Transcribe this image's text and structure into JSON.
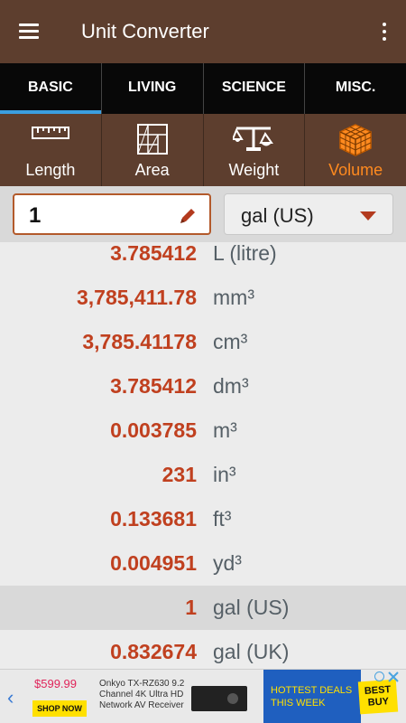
{
  "app": {
    "title": "Unit Converter"
  },
  "tabs": [
    {
      "label": "BASIC"
    },
    {
      "label": "LIVING"
    },
    {
      "label": "SCIENCE"
    },
    {
      "label": "MISC."
    }
  ],
  "categories": [
    {
      "label": "Length",
      "icon": "ruler-icon"
    },
    {
      "label": "Area",
      "icon": "area-grid-icon"
    },
    {
      "label": "Weight",
      "icon": "scale-icon"
    },
    {
      "label": "Volume",
      "icon": "cube-icon"
    }
  ],
  "input": {
    "value": "1",
    "unit": "gal (US)"
  },
  "conversions": [
    {
      "value": "3.785412",
      "unit": "L (litre)"
    },
    {
      "value": "3,785,411.78",
      "unit": "mm³"
    },
    {
      "value": "3,785.41178",
      "unit": "cm³"
    },
    {
      "value": "3.785412",
      "unit": "dm³"
    },
    {
      "value": "0.003785",
      "unit": "m³"
    },
    {
      "value": "231",
      "unit": "in³"
    },
    {
      "value": "0.133681",
      "unit": "ft³"
    },
    {
      "value": "0.004951",
      "unit": "yd³"
    },
    {
      "value": "1",
      "unit": "gal (US)"
    },
    {
      "value": "0.832674",
      "unit": "gal (UK)"
    }
  ],
  "ad": {
    "price": "$599.99",
    "cta": "SHOP NOW",
    "description": "Onkyo TX-RZ630 9.2 Channel 4K Ultra HD Network AV Receiver",
    "headline": "HOTTEST DEALS THIS WEEK",
    "brand": "BEST BUY"
  },
  "colors": {
    "appbar": "#5d3e2e",
    "tab_indicator": "#3b9fe0",
    "active_category": "#ff8a1f",
    "value_text": "#c0401f"
  }
}
